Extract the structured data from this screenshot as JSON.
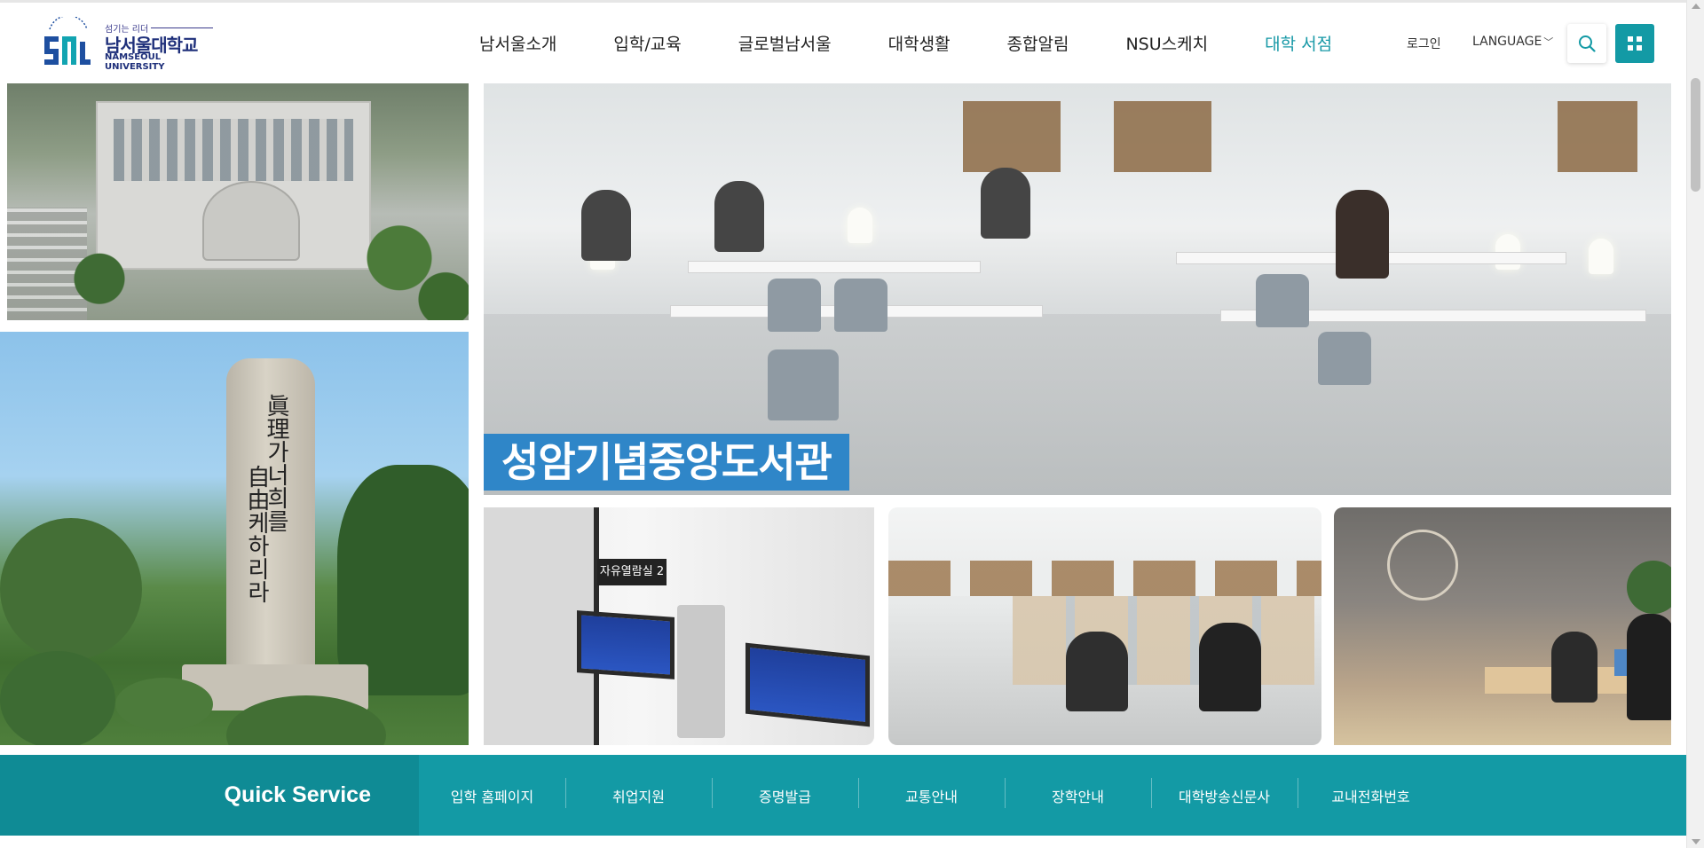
{
  "logo": {
    "slogan": "섬기는 리더",
    "name_kr": "남서울대학교",
    "name_en": "NAMSEOUL UNIVERSITY",
    "mark_icon": "nsu-logo-mark",
    "brand_color": "#1e2f7a"
  },
  "gnb": {
    "items": [
      {
        "label": "남서울소개"
      },
      {
        "label": "입학/교육"
      },
      {
        "label": "글로벌남서울"
      },
      {
        "label": "대학생활"
      },
      {
        "label": "종합알림"
      },
      {
        "label": "NSU스케치"
      },
      {
        "label": "대학 서점",
        "active": true
      }
    ],
    "active_color": "#1698a6"
  },
  "util": {
    "login_label": "로그인",
    "language_label": "LANGUAGE",
    "language_icon": "chevron-down-icon",
    "search_icon": "search-icon",
    "sitemap_icon": "grid-icon",
    "accent_color": "#139aa5"
  },
  "hero": {
    "caption": "성암기념중앙도서관",
    "stone_inscription_1": "眞理가너희를",
    "stone_inscription_2": "自由케하리라",
    "kiosk_sign": "자유열람실 2",
    "caption_color": "#2f86c8"
  },
  "quick": {
    "title": "Quick Service",
    "items": [
      {
        "label": "입학 홈페이지"
      },
      {
        "label": "취업지원"
      },
      {
        "label": "증명발급"
      },
      {
        "label": "교통안내"
      },
      {
        "label": "장학안내"
      },
      {
        "label": "대학방송신문사"
      },
      {
        "label": "교내전화번호"
      }
    ],
    "bg_color": "#139aa5"
  }
}
